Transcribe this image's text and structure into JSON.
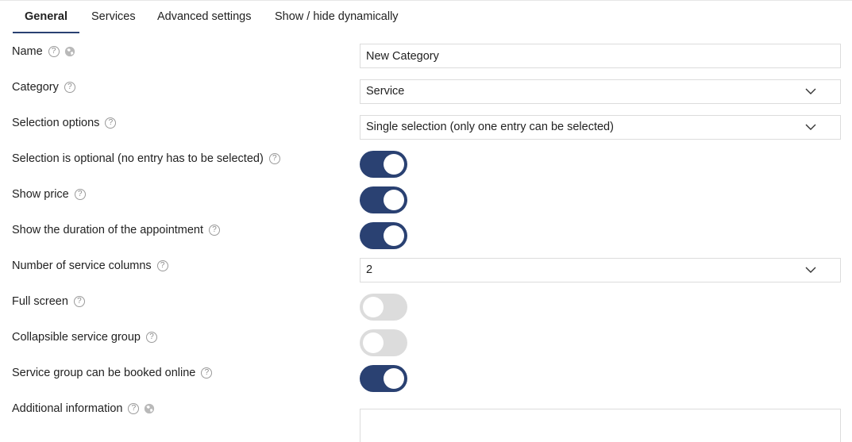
{
  "tabs": {
    "general": "General",
    "services": "Services",
    "advanced": "Advanced settings",
    "showhide": "Show / hide dynamically"
  },
  "form": {
    "name": {
      "label": "Name",
      "value": "New Category"
    },
    "category": {
      "label": "Category",
      "value": "Service"
    },
    "selection_options": {
      "label": "Selection options",
      "value": "Single selection (only one entry can be selected)"
    },
    "selection_optional": {
      "label": "Selection is optional (no entry has to be selected)",
      "enabled": true
    },
    "show_price": {
      "label": "Show price",
      "enabled": true
    },
    "show_duration": {
      "label": "Show the duration of the appointment",
      "enabled": true
    },
    "service_columns": {
      "label": "Number of service columns",
      "value": "2"
    },
    "full_screen": {
      "label": "Full screen",
      "enabled": false
    },
    "collapsible_group": {
      "label": "Collapsible service group",
      "enabled": false
    },
    "bookable_online": {
      "label": "Service group can be booked online",
      "enabled": true
    },
    "additional_info": {
      "label": "Additional information",
      "value": ""
    }
  },
  "help_glyph": "?",
  "colors": {
    "accent": "#2a4172",
    "toggle_off": "#dcdcdc",
    "border": "#dcdcdc"
  },
  "icons": {
    "help": "help-icon",
    "globe": "globe-icon",
    "chevron": "chevron-down-icon"
  }
}
